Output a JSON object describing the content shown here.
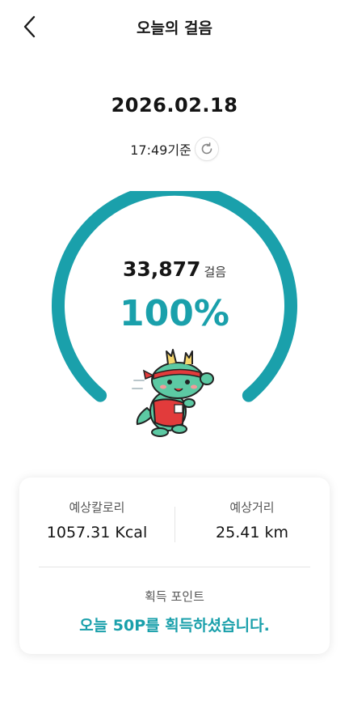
{
  "header": {
    "title": "오늘의 걸음",
    "back_icon": "chevron-left-icon"
  },
  "date": "2026.02.18",
  "as_of": {
    "text": "17:49기준",
    "refresh_icon": "refresh-icon"
  },
  "gauge": {
    "steps_value": "33,877",
    "steps_unit": "걸음",
    "percent_text": "100%",
    "progress": 1.0,
    "color": "#1aa0ab"
  },
  "mascot": {
    "icon": "dragon-mascot-running-icon"
  },
  "summary": {
    "calories_label": "예상칼로리",
    "calories_value": "1057.31 Kcal",
    "distance_label": "예상거리",
    "distance_value": "25.41 km",
    "points_label": "획득 포인트",
    "points_message": "오늘 50P를 획득하셨습니다."
  },
  "colors": {
    "accent": "#1aa0ab",
    "text": "#141414"
  }
}
